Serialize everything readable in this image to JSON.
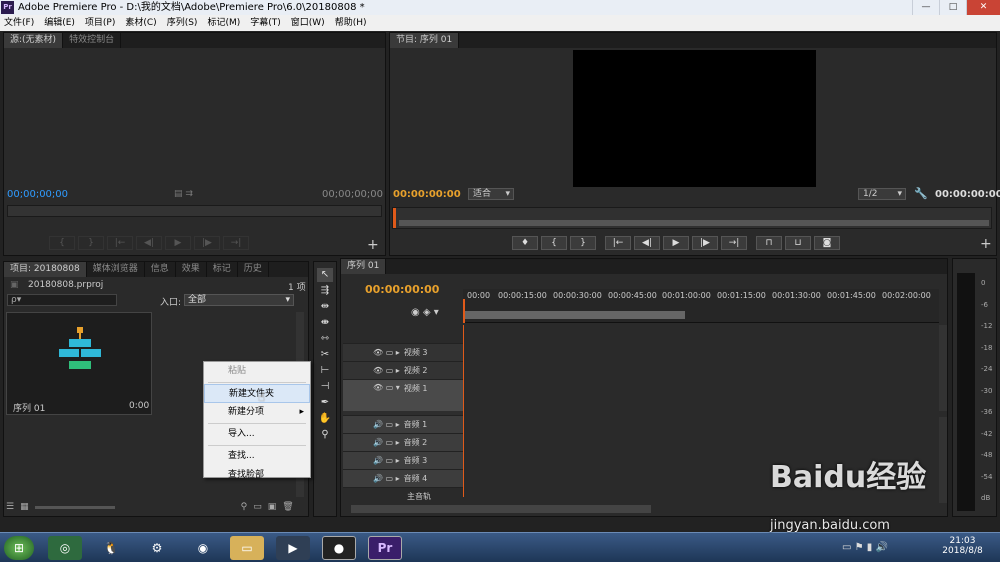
{
  "window": {
    "title": "Adobe Premiere Pro - D:\\我的文档\\Adobe\\Premiere Pro\\6.0\\20180808 *",
    "badge": "Pr",
    "minimize": "—",
    "maximize": "□",
    "close": "✕"
  },
  "menu": [
    "文件(F)",
    "编辑(E)",
    "项目(P)",
    "素材(C)",
    "序列(S)",
    "标记(M)",
    "字幕(T)",
    "窗口(W)",
    "帮助(H)"
  ],
  "source_monitor": {
    "tabs": [
      "源:(无素材)",
      "特效控制台"
    ],
    "timecode_left": "00;00;00;00",
    "timecode_right": "00;00;00;00"
  },
  "program_monitor": {
    "tab": "节目: 序列 01",
    "timecode_left": "00:00:00:00",
    "fit": "适合",
    "resolution": "1/2",
    "timecode_right": "00:00:00:00"
  },
  "project_panel": {
    "tabs": [
      "项目: 20180808",
      "媒体浏览器",
      "信息",
      "效果",
      "标记",
      "历史"
    ],
    "filename": "20180808.prproj",
    "item_count": "1 项",
    "search_placeholder": "ρ▾",
    "entry_label": "入口:",
    "entry_value": "全部",
    "clip_name": "序列 01",
    "clip_duration": "0:00"
  },
  "context_menu": {
    "items": [
      "粘贴",
      "新建文件夹",
      "新建分项",
      "导入...",
      "查找...",
      "查找脸部"
    ]
  },
  "timeline": {
    "tab": "序列 01",
    "timecode": "00:00:00:00",
    "ruler": [
      "00:00",
      "00:00:15:00",
      "00:00:30:00",
      "00:00:45:00",
      "00:01:00:00",
      "00:01:15:00",
      "00:01:30:00",
      "00:01:45:00",
      "00:02:00:00"
    ],
    "video_tracks": [
      "视频 3",
      "视频 2",
      "视频 1"
    ],
    "audio_tracks": [
      "音频 1",
      "音频 2",
      "音频 3",
      "音频 4"
    ],
    "master": "主音轨"
  },
  "audio_meter": {
    "labels": [
      "0",
      "-6",
      "-12",
      "-18",
      "-24",
      "-30",
      "-36",
      "-42",
      "-48",
      "-54",
      "dB"
    ]
  },
  "taskbar": {
    "time": "21:03",
    "date": "2018/8/8"
  },
  "watermark": {
    "brand": "Baidu经验",
    "url": "jingyan.baidu.com"
  },
  "colors": {
    "accent_timecode": "#e8a12c",
    "source_timecode": "#2f9bff",
    "playhead": "#e05a1a"
  }
}
